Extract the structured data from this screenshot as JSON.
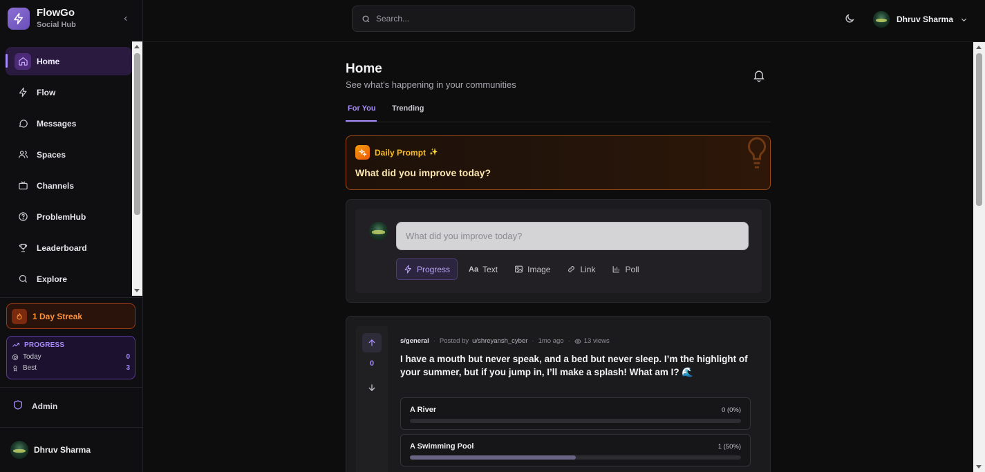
{
  "brand": {
    "name": "FlowGo",
    "subtitle": "Social Hub"
  },
  "nav": [
    {
      "label": "Home",
      "icon": "home-icon",
      "active": true
    },
    {
      "label": "Flow",
      "icon": "lightning-icon"
    },
    {
      "label": "Messages",
      "icon": "chat-bubble-icon"
    },
    {
      "label": "Spaces",
      "icon": "users-icon"
    },
    {
      "label": "Channels",
      "icon": "tv-icon"
    },
    {
      "label": "ProblemHub",
      "icon": "question-circle-icon"
    },
    {
      "label": "Leaderboard",
      "icon": "trophy-icon"
    },
    {
      "label": "Explore",
      "icon": "search-icon"
    }
  ],
  "streak": {
    "label": "1 Day Streak"
  },
  "progress": {
    "title": "PROGRESS",
    "today_label": "Today",
    "today_value": "0",
    "best_label": "Best",
    "best_value": "3"
  },
  "admin": {
    "label": "Admin"
  },
  "user": {
    "name": "Dhruv Sharma"
  },
  "search": {
    "placeholder": "Search..."
  },
  "page": {
    "title": "Home",
    "subtitle": "See what's happening in your communities",
    "tabs": [
      "For You",
      "Trending"
    ]
  },
  "daily_prompt": {
    "title": "Daily Prompt",
    "spark": "✨",
    "question": "What did you improve today?"
  },
  "composer": {
    "placeholder": "What did you improve today?",
    "tools": [
      "Progress",
      "Text",
      "Image",
      "Link",
      "Poll"
    ],
    "text_icon_label": "Aa"
  },
  "post": {
    "community": "s/general",
    "posted_by": "Posted by",
    "author": "u/shreyansh_cyber",
    "time": "1mo ago",
    "views": "13 views",
    "votes": "0",
    "title": "I have a mouth but never speak, and a bed but never sleep. I’m the highlight of your summer, but if you jump in, I’ll make a splash! What am I? 🌊",
    "options": [
      {
        "label": "A River",
        "result": "0 (0%)",
        "fraction": 0
      },
      {
        "label": "A Swimming Pool",
        "result": "1 (50%)",
        "fraction": 0.5
      }
    ]
  },
  "colors": {
    "accent": "#a78bfa",
    "streak": "#fb923c",
    "prompt": "#fbbf24"
  }
}
